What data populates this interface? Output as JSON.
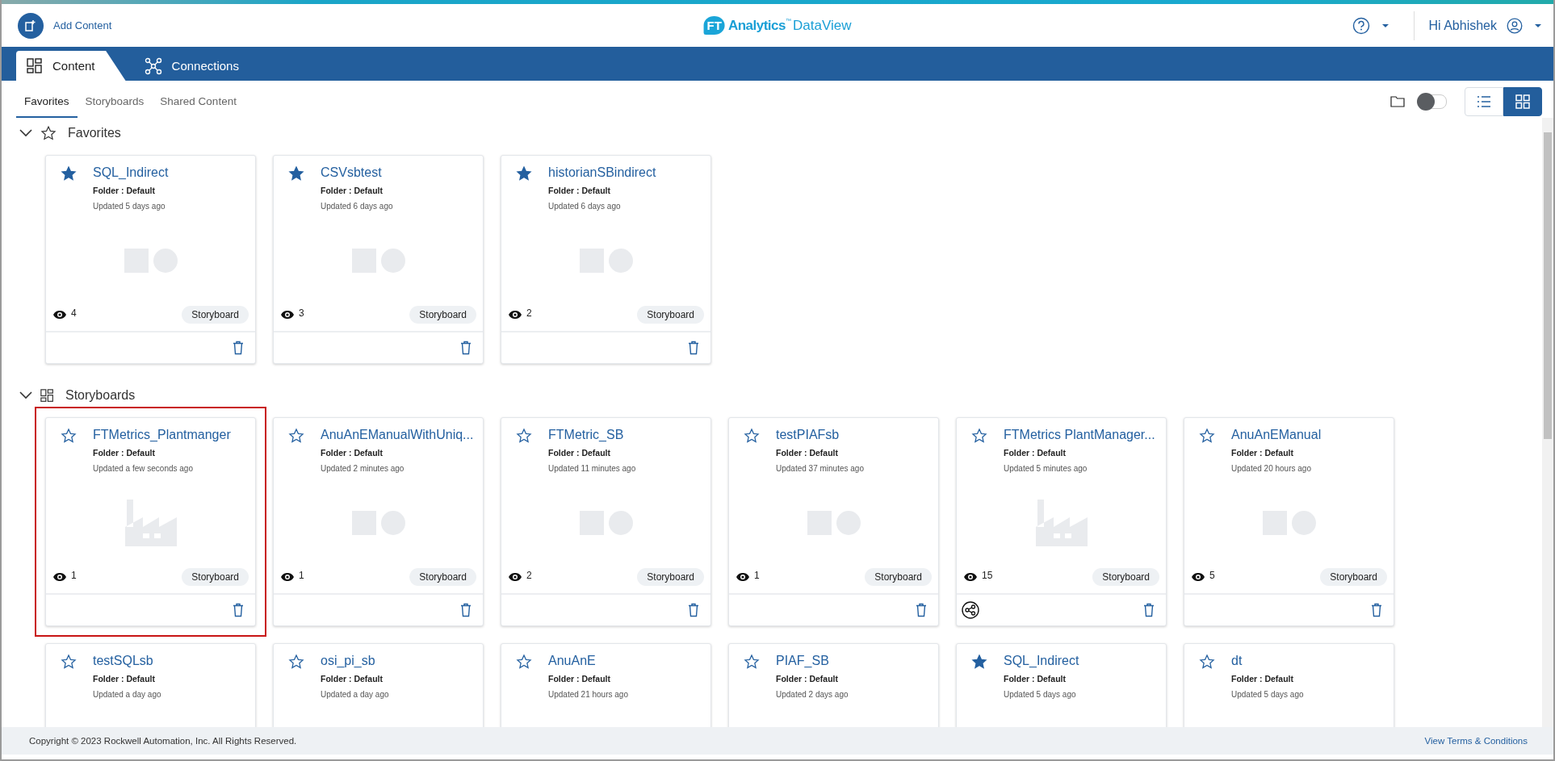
{
  "header": {
    "add_content": "Add Content",
    "logo": {
      "badge": "FT",
      "name": "Analytics",
      "tm": "™",
      "product": "DataView"
    },
    "greeting": "Hi Abhishek"
  },
  "main_tabs": [
    {
      "label": "Content",
      "selected": true
    },
    {
      "label": "Connections",
      "selected": false
    }
  ],
  "sub_tabs": [
    {
      "label": "Favorites",
      "selected": true
    },
    {
      "label": "Storyboards",
      "selected": false
    },
    {
      "label": "Shared Content",
      "selected": false
    }
  ],
  "toolbar": {
    "toggle_on": false,
    "views": [
      {
        "selected": false
      },
      {
        "selected": true
      }
    ]
  },
  "sections": [
    {
      "title": "Favorites",
      "expanded": true,
      "cards": [
        {
          "title": "SQL_Indirect",
          "folder": "Folder : Default",
          "updated": "Updated 5 days ago",
          "favorite": true,
          "kind": "shapes",
          "views": "4",
          "badge": "Storyboard",
          "shared": false,
          "selected": false
        },
        {
          "title": "CSVsbtest",
          "folder": "Folder : Default",
          "updated": "Updated 6 days ago",
          "favorite": true,
          "kind": "shapes",
          "views": "3",
          "badge": "Storyboard",
          "shared": false,
          "selected": false
        },
        {
          "title": "historianSBindirect",
          "folder": "Folder : Default",
          "updated": "Updated 6 days ago",
          "favorite": true,
          "kind": "shapes",
          "views": "2",
          "badge": "Storyboard",
          "shared": false,
          "selected": false
        }
      ]
    },
    {
      "title": "Storyboards",
      "expanded": true,
      "cards": [
        {
          "title": "FTMetrics_Plantmanger",
          "folder": "Folder : Default",
          "updated": "Updated a few seconds ago",
          "favorite": false,
          "kind": "factory",
          "views": "1",
          "badge": "Storyboard",
          "shared": false,
          "selected": true
        },
        {
          "title": "AnuAnEManualWithUniq...",
          "folder": "Folder : Default",
          "updated": "Updated 2 minutes ago",
          "favorite": false,
          "kind": "shapes",
          "views": "1",
          "badge": "Storyboard",
          "shared": false,
          "selected": false
        },
        {
          "title": "FTMetric_SB",
          "folder": "Folder : Default",
          "updated": "Updated 11 minutes ago",
          "favorite": false,
          "kind": "shapes",
          "views": "2",
          "badge": "Storyboard",
          "shared": false,
          "selected": false
        },
        {
          "title": "testPIAFsb",
          "folder": "Folder : Default",
          "updated": "Updated 37 minutes ago",
          "favorite": false,
          "kind": "shapes",
          "views": "1",
          "badge": "Storyboard",
          "shared": false,
          "selected": false
        },
        {
          "title": "FTMetrics PlantManager...",
          "folder": "Folder : Default",
          "updated": "Updated 5 minutes ago",
          "favorite": false,
          "kind": "factory",
          "views": "15",
          "badge": "Storyboard",
          "shared": true,
          "selected": false
        },
        {
          "title": "AnuAnEManual",
          "folder": "Folder : Default",
          "updated": "Updated 20 hours ago",
          "favorite": false,
          "kind": "shapes",
          "views": "5",
          "badge": "Storyboard",
          "shared": false,
          "selected": false
        },
        {
          "title": "testSQLsb",
          "folder": "Folder : Default",
          "updated": "Updated a day ago",
          "favorite": false,
          "selected": false
        },
        {
          "title": "osi_pi_sb",
          "folder": "Folder : Default",
          "updated": "Updated a day ago",
          "favorite": false,
          "selected": false
        },
        {
          "title": "AnuAnE",
          "folder": "Folder : Default",
          "updated": "Updated 21 hours ago",
          "favorite": false,
          "selected": false
        },
        {
          "title": "PIAF_SB",
          "folder": "Folder : Default",
          "updated": "Updated 2 days ago",
          "favorite": false,
          "selected": false
        },
        {
          "title": "SQL_Indirect",
          "folder": "Folder : Default",
          "updated": "Updated 5 days ago",
          "favorite": true,
          "selected": false
        },
        {
          "title": "dt",
          "folder": "Folder : Default",
          "updated": "Updated 5 days ago",
          "favorite": false,
          "selected": false
        }
      ]
    }
  ],
  "footer": {
    "copyright": "Copyright © 2023 Rockwell Automation, Inc. All Rights Reserved.",
    "link": "View Terms & Conditions"
  }
}
